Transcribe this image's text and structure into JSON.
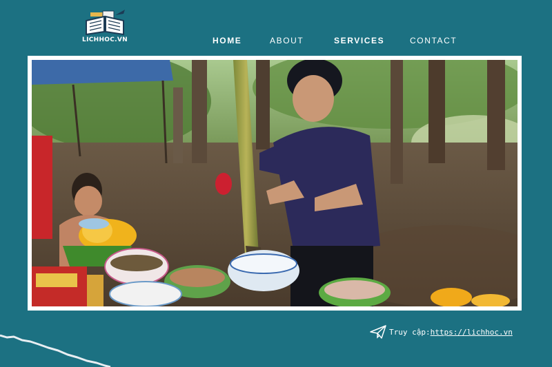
{
  "logo": {
    "text": "LICHHOC.VN",
    "icon": "open-book-icon"
  },
  "nav": {
    "home": "HOME",
    "about": "ABOUT",
    "services": "SERVICES",
    "contact": "CONTACT"
  },
  "footer": {
    "prefix": "Truy cập: ",
    "url": "https://lichhoc.vn",
    "icon": "paper-plane-icon"
  },
  "colors": {
    "background": "#1c7182",
    "frame": "#ffffff",
    "text": "#ffffff"
  }
}
